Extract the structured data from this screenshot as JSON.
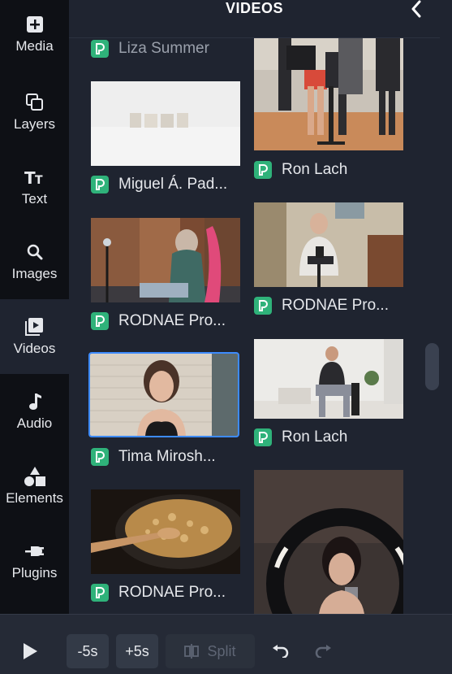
{
  "sidebar": {
    "items": [
      {
        "label": "Media",
        "icon": "media-plus-icon"
      },
      {
        "label": "Layers",
        "icon": "layers-icon"
      },
      {
        "label": "Text",
        "icon": "text-icon"
      },
      {
        "label": "Images",
        "icon": "search-icon"
      },
      {
        "label": "Videos",
        "icon": "video-play-icon"
      },
      {
        "label": "Audio",
        "icon": "music-note-icon"
      },
      {
        "label": "Elements",
        "icon": "shapes-icon"
      },
      {
        "label": "Plugins",
        "icon": "plug-icon"
      }
    ]
  },
  "panel": {
    "title": "VIDEOS",
    "back_icon": "chevron-left-icon",
    "videos": [
      {
        "author": "Liza Summer",
        "thumbnail": "partial, scrolled out of view"
      },
      {
        "author": "Miguel Á. Pad...",
        "thumbnail": "small white objects on white table"
      },
      {
        "author": "RODNAE Pro...",
        "thumbnail": "woman with headscarf and pink fabric by brick wall"
      },
      {
        "author": "Tima Mirosh...",
        "thumbnail": "woman talking in front of white brick wall",
        "selected": true
      },
      {
        "author": "RODNAE Pro...",
        "thumbnail": "cooking pasta in a pan"
      },
      {
        "author": "",
        "thumbnail": "people walking with phone on gimbal"
      },
      {
        "author": "Ron Lach",
        "thumbnail": ""
      },
      {
        "author": "RODNAE Pro...",
        "thumbnail": "man sitting recording with phone"
      },
      {
        "author": "Ron Lach",
        "thumbnail": "man on chair holding phone in bright room"
      },
      {
        "author": "",
        "thumbnail": "woman with ring light filming with phone"
      }
    ],
    "badge_icon": "pexels-badge-icon"
  },
  "toolbar": {
    "play_icon": "play-icon",
    "minus5": "-5s",
    "plus5": "+5s",
    "split": "Split",
    "split_icon": "split-icon",
    "undo_icon": "undo-icon",
    "redo_icon": "redo-icon"
  },
  "colors": {
    "sidebar_bg": "#0e1015",
    "panel_bg": "#1f2430",
    "accent_selected": "#3d8bfd",
    "badge_green": "#2fb27a"
  }
}
